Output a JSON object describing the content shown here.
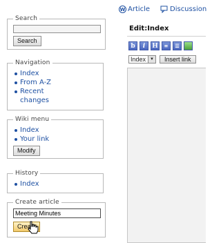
{
  "sidebar": {
    "search": {
      "legend": "Search",
      "input_value": "",
      "button_label": "Search"
    },
    "navigation": {
      "legend": "Navigation",
      "items": [
        "Index",
        "From A-Z",
        "Recent",
        "changes"
      ]
    },
    "wiki_menu": {
      "legend": "Wiki menu",
      "items": [
        "Index",
        "Your link"
      ],
      "button_label": "Modify"
    },
    "history": {
      "legend": "History",
      "items": [
        "Index"
      ]
    },
    "create_article": {
      "legend": "Create article",
      "input_value": "Meeting Minutes",
      "button_label": "Create"
    }
  },
  "main": {
    "tabs": [
      {
        "label": "Article",
        "icon": "w-circle-icon"
      },
      {
        "label": "Discussion",
        "icon": "discussion-icon"
      }
    ],
    "edit_title": "Edit:Index",
    "toolbar": {
      "buttons": [
        "b",
        "i",
        "H"
      ],
      "select_value": "Index",
      "insert_link_label": "Insert link"
    }
  }
}
